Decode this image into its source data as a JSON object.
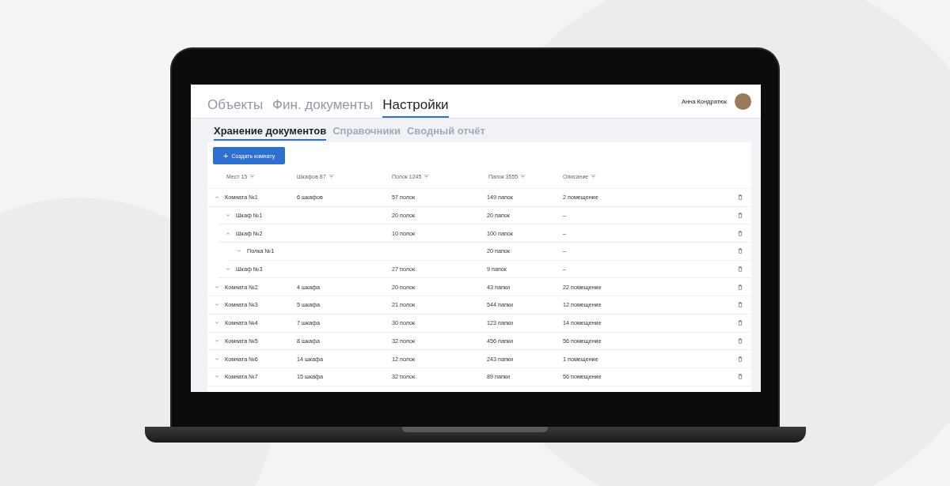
{
  "main_tabs": [
    {
      "label": "Объекты",
      "selected": false
    },
    {
      "label": "Фин. документы",
      "selected": false
    },
    {
      "label": "Настройки",
      "selected": true
    }
  ],
  "user": {
    "name": "Анна Кондратюк"
  },
  "sub_tabs": [
    {
      "label": "Хранение документов",
      "selected": true
    },
    {
      "label": "Справочники",
      "selected": false
    },
    {
      "label": "Сводный отчёт",
      "selected": false
    }
  ],
  "create_button": {
    "icon": "+",
    "label": "Создать комнату"
  },
  "table": {
    "columns": [
      "Мест 15",
      "Шкафов 87",
      "Полок 1245",
      "Папок 3555",
      "Описание"
    ],
    "rows": [
      {
        "name": "Комната №1",
        "cabinets": "6 шкафов",
        "shelves": "57 полок",
        "folders": "149 папок",
        "description": "2 помещение",
        "expanded": true,
        "children": [
          {
            "name": "Шкаф №1",
            "shelves": "20 полок",
            "folders": "20 папок",
            "description": "–",
            "expanded": false
          },
          {
            "name": "Шкаф №2",
            "shelves": "10 полок",
            "folders": "100 папок",
            "description": "–",
            "expanded": true,
            "children": [
              {
                "name": "Полка №1",
                "folders": "20 папок",
                "description": "–",
                "expanded": false
              }
            ]
          },
          {
            "name": "Шкаф №3",
            "shelves": "27 полок",
            "folders": "9 папок",
            "description": "–",
            "expanded": false
          }
        ]
      },
      {
        "name": "Комната №2",
        "cabinets": "4 шкафа",
        "shelves": "20 полок",
        "folders": "43 папки",
        "description": "22 помещение",
        "expanded": false
      },
      {
        "name": "Комната №3",
        "cabinets": "5 шкафа",
        "shelves": "21 полок",
        "folders": "544 папки",
        "description": "12 помещение",
        "expanded": false
      },
      {
        "name": "Комната №4",
        "cabinets": "7 шкафа",
        "shelves": "30 полок",
        "folders": "123 папки",
        "description": "14 помещение",
        "expanded": false
      },
      {
        "name": "Комната №5",
        "cabinets": "8 шкафа",
        "shelves": "32 полок",
        "folders": "456 папки",
        "description": "56 помещение",
        "expanded": false
      },
      {
        "name": "Комната №6",
        "cabinets": "14 шкафа",
        "shelves": "12 полок",
        "folders": "243 папки",
        "description": "1 помещение",
        "expanded": false
      },
      {
        "name": "Комната №7",
        "cabinets": "15 шкафа",
        "shelves": "32 полок",
        "folders": "89 папки",
        "description": "56 помещение",
        "expanded": false
      }
    ]
  }
}
